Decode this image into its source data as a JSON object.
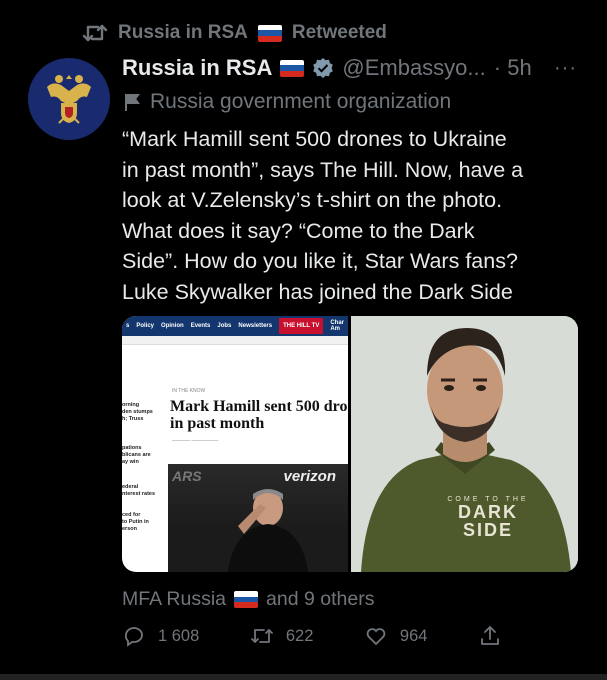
{
  "retweet_bar": {
    "account": "Russia in RSA",
    "label": "Retweeted"
  },
  "tweet": {
    "name": "Russia in RSA",
    "handle": "@Embassyo...",
    "time": "· 5h",
    "more": "···",
    "org_label": "Russia government organization",
    "text": "“Mark Hamill sent 500 drones to Ukraine\nin past month”, says The Hill. Now, have a\nlook at V.Zelensky’s t-shirt on the photo.\nWhat does it say? “Come to the Dark\nSide”. How do you like it, Star Wars fans?\nLuke Skywalker has joined the Dark Side"
  },
  "media": {
    "article": {
      "nav_items": [
        "s",
        "Policy",
        "Opinion",
        "Events",
        "Jobs",
        "Newsletters"
      ],
      "nav_brand": "THE HILL TV",
      "nav_extra": "Char\nAm",
      "kicker": "IN THE KNOW",
      "headline": "Mark Hamill sent 500 dro\nin past month",
      "sidebar_snippets": [
        "orning\nden stumps\nh; Truss",
        "pations\nblicans are\nay win",
        "ederal\nnterest rates",
        "ced for\nto Putin in\nerson"
      ],
      "photo_text_left": "ARS",
      "photo_text_right": "verizon"
    },
    "shirt_text": [
      "COME TO THE",
      "DARK",
      "SIDE"
    ]
  },
  "caption": {
    "source": "MFA Russia",
    "others": "and 9 others"
  },
  "actions": {
    "replies": "1 608",
    "retweets": "622",
    "likes": "964"
  },
  "colors": {
    "background": "#000000",
    "secondary": "#71767b",
    "text": "#e7e9ea",
    "avatar_bg": "#1a2a6e"
  }
}
